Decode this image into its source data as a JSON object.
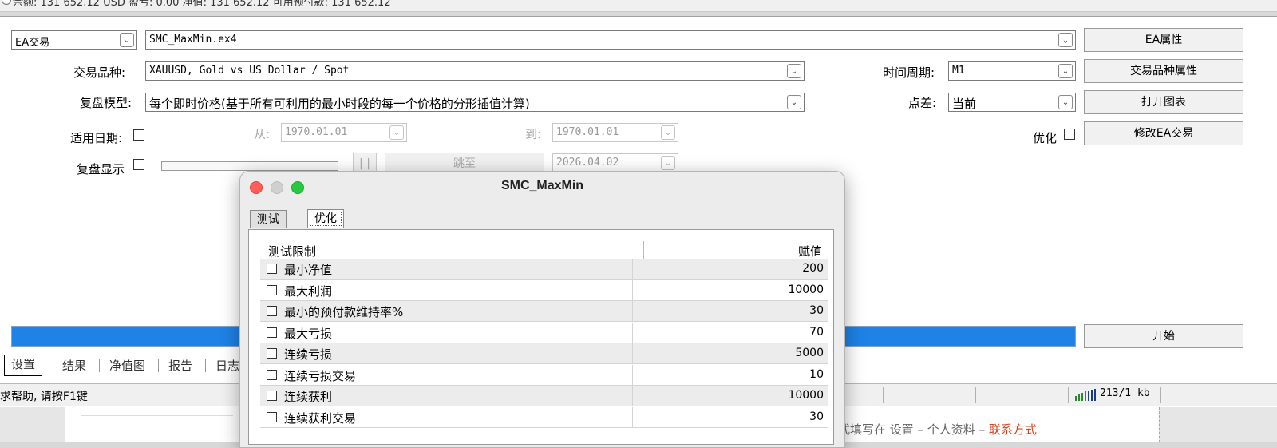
{
  "top_strip": {
    "text": "余额: 131 652.12 USD  盈亏: 0.00  净值: 131 652.12  可用预付款: 131 652.12"
  },
  "tester": {
    "mode": "EA交易",
    "expert": "SMC_MaxMin.ex4",
    "symbol_label": "交易品种:",
    "symbol": "XAUUSD, Gold vs US Dollar / Spot",
    "model_label": "复盘模型:",
    "model": "每个即时价格(基于所有可利用的最小时段的每一个价格的分形插值计算)",
    "use_date_label": "适用日期:",
    "from_label": "从:",
    "from_date": "1970.01.01",
    "to_label": "到:",
    "to_date": "1970.01.01",
    "visual_label": "复盘显示",
    "pause_label": "| |",
    "skip_label": "跳至",
    "skip_date": "2026.04.02",
    "period_label": "时间周期:",
    "period": "M1",
    "spread_label": "点差:",
    "spread": "当前",
    "optimize_label": "优化",
    "btn_ea_props": "EA属性",
    "btn_symbol_props": "交易品种属性",
    "btn_open_chart": "打开图表",
    "btn_modify_ea": "修改EA交易",
    "btn_start": "开始",
    "progress": 1.0,
    "progress_color": "#1e82e6"
  },
  "tabs": [
    {
      "label": "设置",
      "active": true
    },
    {
      "label": "结果"
    },
    {
      "label": "净值图"
    },
    {
      "label": "报告"
    },
    {
      "label": "日志"
    }
  ],
  "statusbar": {
    "help": "求帮助, 请按F1键",
    "net": "213/1 kb"
  },
  "web": {
    "text": "式填写在 设置 – 个人资料 – ",
    "link": "联系方式"
  },
  "modal": {
    "title": "SMC_MaxMin",
    "tabs": [
      "测试",
      "优化"
    ],
    "header_name": "测试限制",
    "header_value": "赋值",
    "rows": [
      {
        "name": "最小净值",
        "value": "200"
      },
      {
        "name": "最大利润",
        "value": "10000"
      },
      {
        "name": "最小的预付款维持率%",
        "value": "30"
      },
      {
        "name": "最大亏损",
        "value": "70"
      },
      {
        "name": "连续亏损",
        "value": "5000"
      },
      {
        "name": "连续亏损交易",
        "value": "10"
      },
      {
        "name": "连续获利",
        "value": "10000"
      },
      {
        "name": "连续获利交易",
        "value": "30"
      }
    ]
  }
}
